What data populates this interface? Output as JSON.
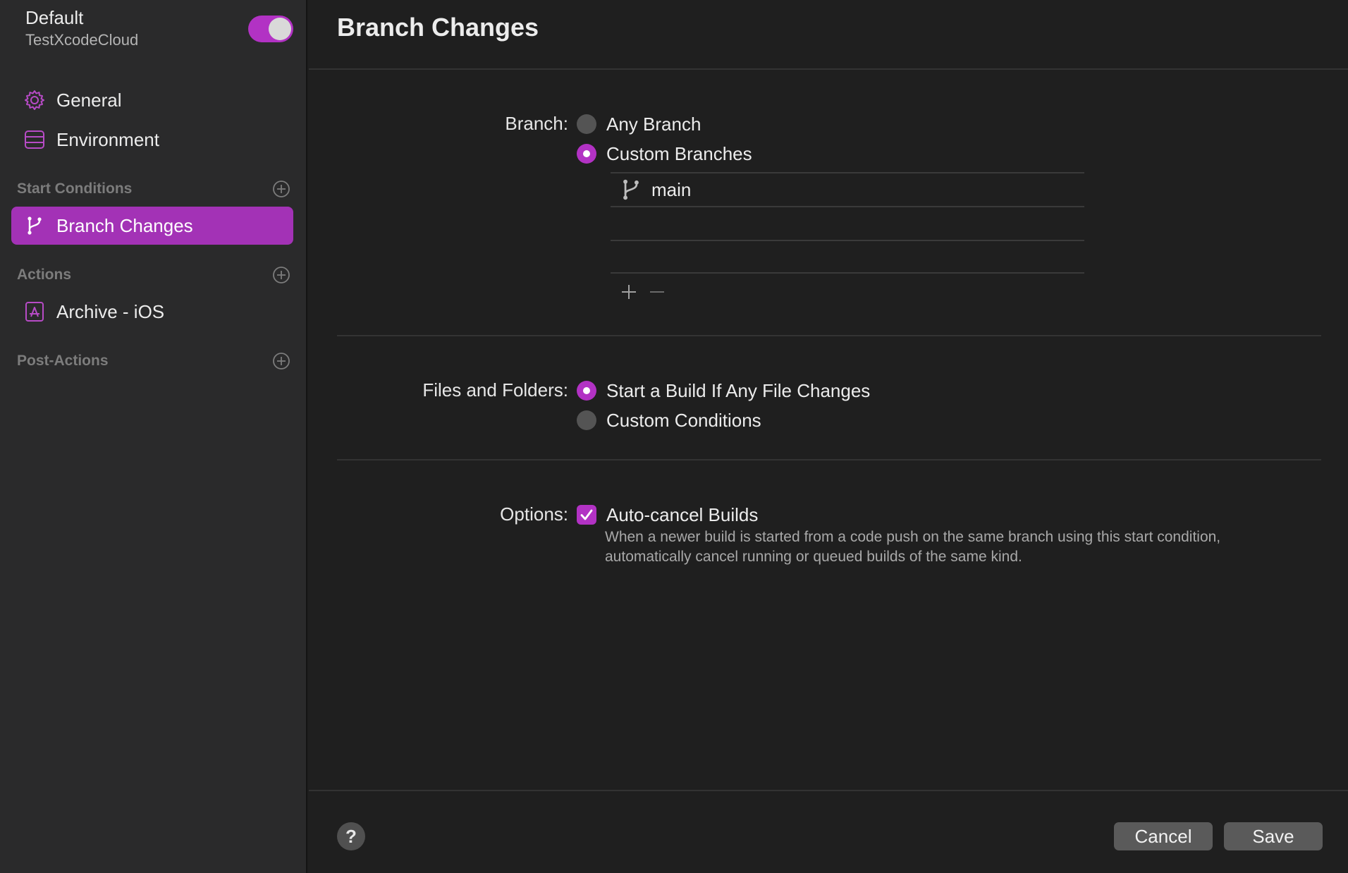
{
  "workflow": {
    "name": "Default",
    "product": "TestXcodeCloud",
    "enabled": true
  },
  "sidebar": {
    "top_items": [
      {
        "label": "General",
        "icon": "gear-icon"
      },
      {
        "label": "Environment",
        "icon": "server-icon"
      }
    ],
    "sections": {
      "start_conditions": "Start Conditions",
      "actions": "Actions",
      "post_actions": "Post-Actions"
    },
    "start_condition_items": [
      {
        "label": "Branch Changes",
        "icon": "branch-icon",
        "selected": true
      }
    ],
    "action_items": [
      {
        "label": "Archive - iOS",
        "icon": "app-store-icon"
      }
    ]
  },
  "main": {
    "title": "Branch Changes",
    "branch": {
      "label": "Branch:",
      "options": [
        "Any Branch",
        "Custom Branches"
      ],
      "selected": "Custom Branches",
      "branches": [
        "main"
      ],
      "add_symbol": "+",
      "remove_symbol": "—"
    },
    "files": {
      "label": "Files and Folders:",
      "options": [
        "Start a Build If Any File Changes",
        "Custom Conditions"
      ],
      "selected": "Start a Build If Any File Changes"
    },
    "options": {
      "label": "Options:",
      "checkbox_label": "Auto-cancel Builds",
      "checked": true,
      "description": "When a newer build is started from a code push on the same branch using this start condition, automatically cancel running or queued builds of the same kind."
    }
  },
  "footer": {
    "help": "?",
    "cancel": "Cancel",
    "save": "Save"
  },
  "colors": {
    "accent": "#b232c4",
    "selection": "#a332b6",
    "sidebar_bg": "#2a2a2b",
    "main_bg": "#1f1f1f"
  }
}
